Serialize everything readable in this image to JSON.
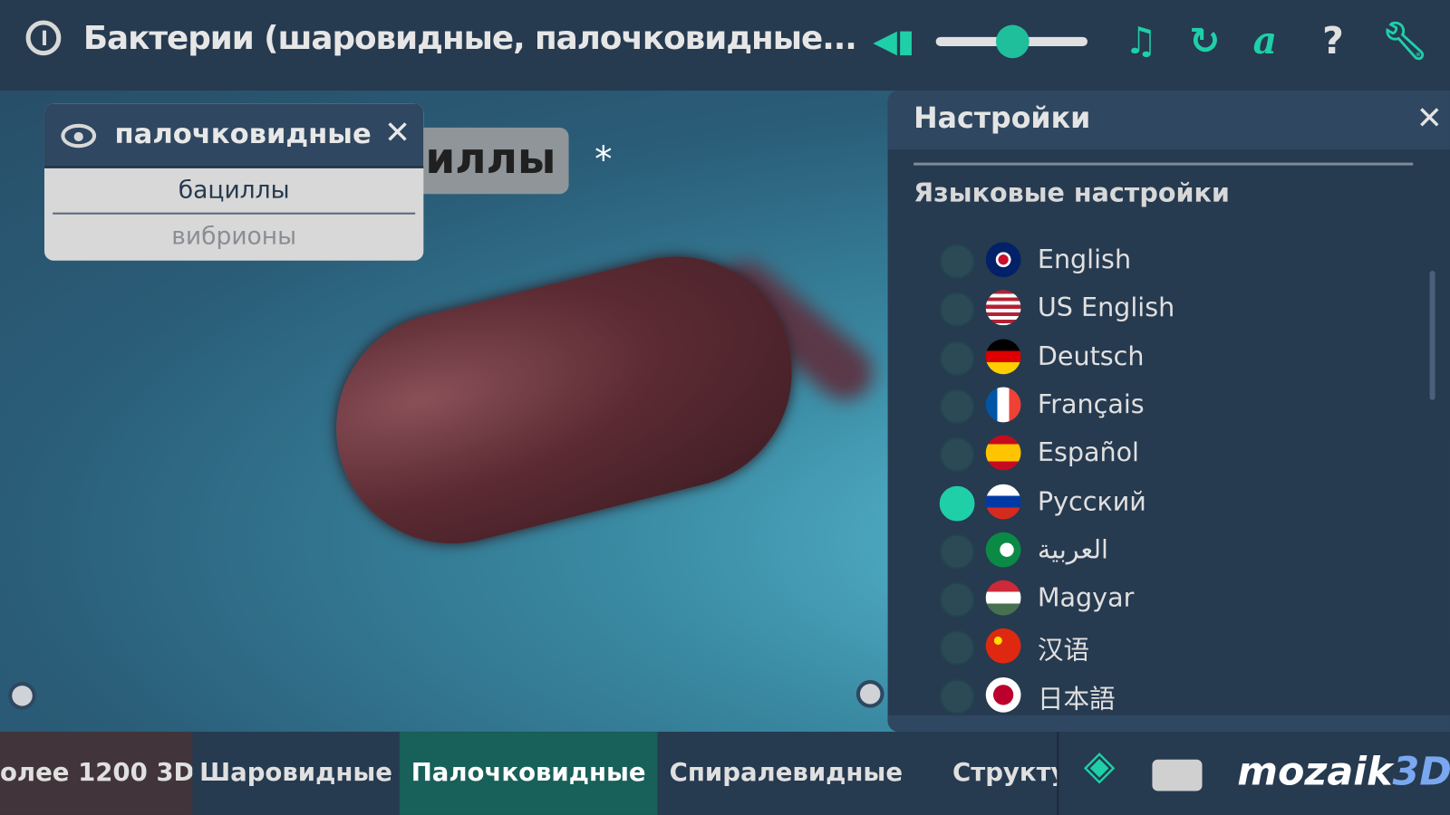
{
  "header": {
    "title": "Бактерии (шаровидные, палочковидные...",
    "volume_percent": 50,
    "icons": [
      "power-icon",
      "speaker-icon",
      "music-icon",
      "reset-icon",
      "font-icon",
      "help-icon",
      "wrench-icon"
    ],
    "accent": "#1fcfa8"
  },
  "popup": {
    "title": "палочковидные",
    "items": [
      "бациллы",
      "вибрионы"
    ]
  },
  "scene": {
    "label": "иллы",
    "marker": "*"
  },
  "settings": {
    "title": "Настройки",
    "section": "Языковые настройки",
    "selected": "Русский",
    "languages": [
      "English",
      "US English",
      "Deutsch",
      "Français",
      "Español",
      "Русский",
      "العربية",
      "Magyar",
      "汉语",
      "日本語"
    ]
  },
  "bottom": {
    "tabs": [
      "олее 1200 3D",
      "Шаровидные",
      "Палочковидные",
      "Спиралевидные",
      "Структу"
    ],
    "active": "Палочковидные",
    "logo_text": "mozaik",
    "logo_suffix": "3D"
  }
}
